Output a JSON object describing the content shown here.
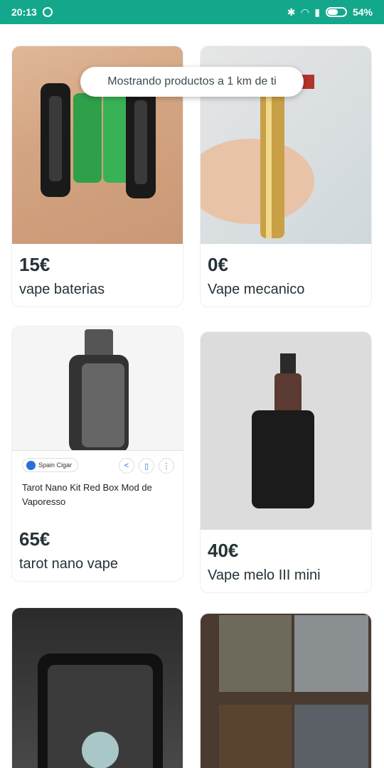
{
  "status_bar": {
    "time": "20:13",
    "battery": "54%"
  },
  "location_banner": {
    "text": "Mostrando productos a 1 km de ti"
  },
  "products": [
    {
      "price": "15€",
      "title": "vape baterias"
    },
    {
      "price": "0€",
      "title": "Vape mecanico"
    },
    {
      "price": "65€",
      "title": "tarot nano vape",
      "photo_overlay": {
        "chip": "Spain Cigar",
        "text": "Tarot Nano Kit Red Box Mod de Vaporesso"
      }
    },
    {
      "price": "40€",
      "title": "Vape melo III mini"
    }
  ],
  "colors": {
    "status_bar": "#13a88c",
    "text": "#253238"
  }
}
